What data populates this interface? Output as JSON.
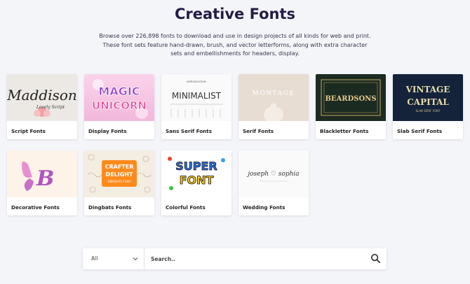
{
  "header": {
    "title": "Creative Fonts",
    "description": "Browse over 226,898 fonts to download and use in design projects of all kinds for web and print. These font sets feature hand-drawn, brush, and vector letterforms, along with extra character sets and embellishments for headers, display."
  },
  "categories": [
    {
      "label": "Script Fonts",
      "thumb_text": "Maddison",
      "thumb_sub": "Lovely Script"
    },
    {
      "label": "Display Fonts",
      "thumb_text": "MAGIC",
      "thumb_text2": "UNICORN"
    },
    {
      "label": "Sans Serif Fonts",
      "thumb_text": "MINIMALIST",
      "thumb_sub": "INTRODUCTION"
    },
    {
      "label": "Serif Fonts",
      "thumb_text": "MONTAGE"
    },
    {
      "label": "Blackletter Fonts",
      "thumb_text": "BEARDSONS"
    },
    {
      "label": "Slab Serif Fonts",
      "thumb_text": "VINTAGE",
      "thumb_text2": "CAPITAL",
      "thumb_sub": "SLAB SERIF FONT"
    },
    {
      "label": "Decorative Fonts",
      "thumb_text": "B"
    },
    {
      "label": "Dingbats Fonts",
      "thumb_text": "CRAFTER",
      "thumb_text2": "DELIGHT",
      "thumb_sub": "DINGBATS FONT"
    },
    {
      "label": "Colorful Fonts",
      "thumb_text": "SUPER",
      "thumb_text2": "FONT"
    },
    {
      "label": "Wedding Fonts",
      "thumb_text": "joseph ♡ sophia"
    }
  ],
  "search": {
    "select_value": "All",
    "placeholder": "Search..",
    "icon": "search-icon"
  },
  "colors": {
    "background": "#f4f5f9",
    "title": "#241c46"
  }
}
